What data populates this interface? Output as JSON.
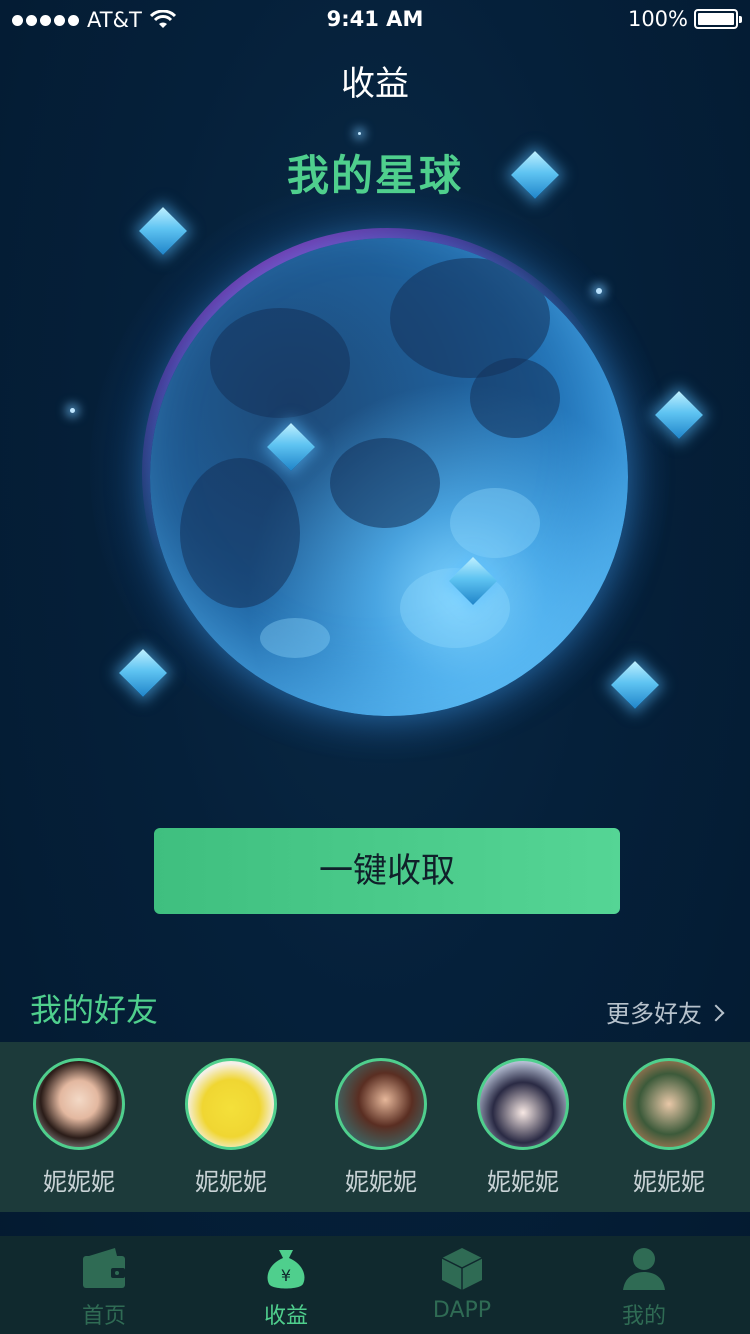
{
  "status_bar": {
    "carrier": "AT&T",
    "time": "9:41 AM",
    "battery": "100%"
  },
  "header": {
    "title": "收益"
  },
  "planet": {
    "title": "我的星球"
  },
  "collect": {
    "label": "一键收取"
  },
  "friends": {
    "title": "我的好友",
    "more_label": "更多好友",
    "items": [
      {
        "name": "妮妮妮"
      },
      {
        "name": "妮妮妮"
      },
      {
        "name": "妮妮妮"
      },
      {
        "name": "妮妮妮"
      },
      {
        "name": "妮妮妮"
      }
    ]
  },
  "tabs": [
    {
      "label": "首页",
      "icon": "wallet-icon"
    },
    {
      "label": "收益",
      "icon": "money-bag-icon"
    },
    {
      "label": "DAPP",
      "icon": "cube-icon"
    },
    {
      "label": "我的",
      "icon": "person-icon"
    }
  ],
  "colors": {
    "accent": "#4fcf8d",
    "background": "#041a30",
    "tab_inactive": "#2f6b54"
  }
}
